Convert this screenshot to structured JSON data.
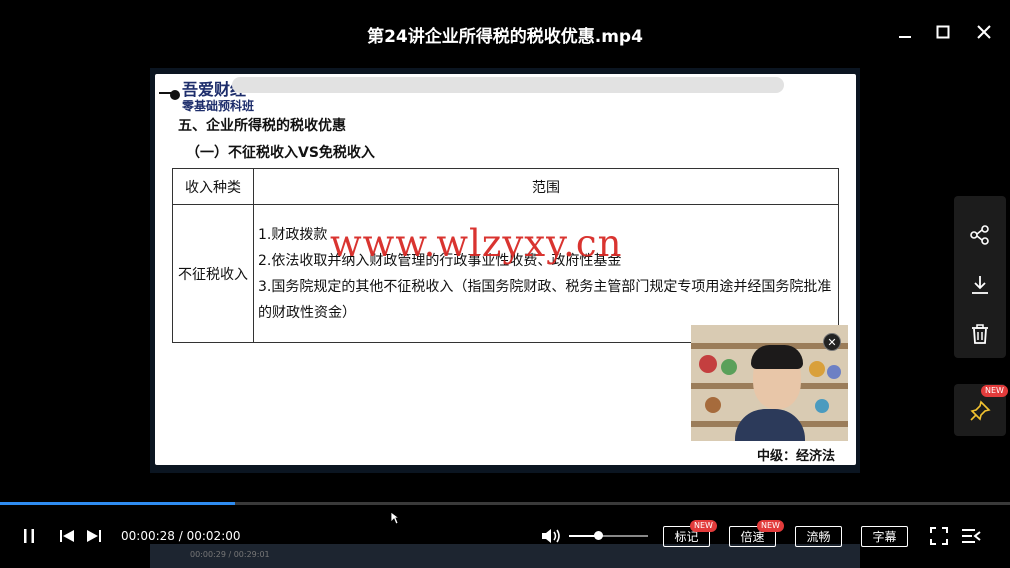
{
  "window": {
    "title": "第24讲企业所得税的税收优惠.mp4"
  },
  "slide": {
    "logo_main": "吾爱财经",
    "logo_sub": "零基础预科班",
    "heading1": "五、企业所得税的税收优惠",
    "heading2": "（一）不征税收入VS免税收入",
    "table": {
      "headers": [
        "收入种类",
        "范围"
      ],
      "row": {
        "category": "不征税收入",
        "items": [
          "1.财政拨款",
          "2.依法收取并纳入财政管理的行政事业性收费、政府性基金",
          "3.国务院规定的其他不征税收入（指国务院财政、税务主管部门规定专项用途并经国务院批准的财政性资金）"
        ]
      }
    },
    "watermark": "www.wlzyxy.cn",
    "footer": "中级：经济法"
  },
  "player": {
    "current_time": "00:00:28",
    "separator": "/",
    "duration": "00:02:00",
    "progress": 0.233,
    "volume": 0.37,
    "ghost_time": "00:00:29 / 00:29:01",
    "buttons": {
      "mark": "标记",
      "speed": "倍速",
      "quality": "流畅",
      "subtitle": "字幕"
    },
    "badge_new": "NEW"
  },
  "side_panel": {
    "icons": [
      "share-icon",
      "download-icon",
      "trash-icon",
      "pin-icon"
    ]
  },
  "colors": {
    "accent": "#2f8cf0",
    "watermark": "#d72a25",
    "badge": "#e23b3b"
  }
}
